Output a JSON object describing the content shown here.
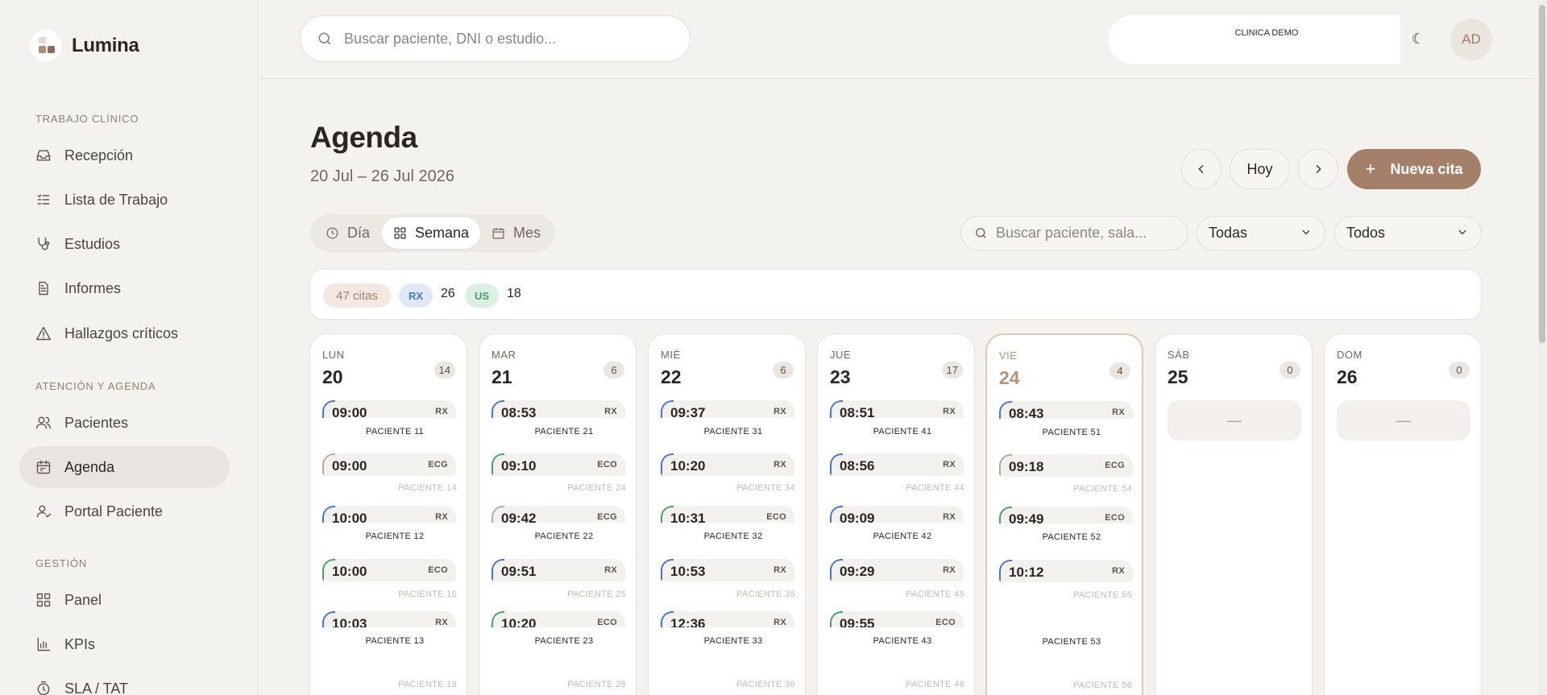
{
  "brand": {
    "name": "Lumina"
  },
  "sidebar": {
    "sections": [
      {
        "title": "TRABAJO CLÍNICO"
      },
      {
        "title": "ATENCIÓN Y AGENDA"
      },
      {
        "title": "GESTIÓN"
      }
    ],
    "items": [
      {
        "label": "Recepción",
        "icon": "inbox-icon"
      },
      {
        "label": "Lista de Trabajo",
        "icon": "list-check-icon"
      },
      {
        "label": "Estudios",
        "icon": "stethoscope-icon"
      },
      {
        "label": "Informes",
        "icon": "document-icon"
      },
      {
        "label": "Hallazgos críticos",
        "icon": "warning-icon"
      },
      {
        "label": "Pacientes",
        "icon": "users-icon"
      },
      {
        "label": "Agenda",
        "icon": "calendar-icon",
        "active": true
      },
      {
        "label": "Portal Paciente",
        "icon": "user-portal-icon"
      },
      {
        "label": "Panel",
        "icon": "grid-icon"
      },
      {
        "label": "KPIs",
        "icon": "bar-chart-icon"
      },
      {
        "label": "SLA / TAT",
        "icon": "timer-icon"
      }
    ]
  },
  "topbar": {
    "search_placeholder": "Buscar paciente, DNI o estudio...",
    "clinic": "CLINICA DEMO",
    "avatar": "AD"
  },
  "page": {
    "title": "Agenda",
    "date_range": "20 Jul – 26 Jul 2026",
    "today_label": "Hoy",
    "new_label": "Nueva cita"
  },
  "views": {
    "day": "Día",
    "week": "Semana",
    "month": "Mes",
    "active": "Semana"
  },
  "filters": {
    "search_placeholder": "Buscar paciente, sala...",
    "room": "Todas",
    "type": "Todos"
  },
  "summary": {
    "total": "47 citas",
    "rx_label": "RX",
    "rx_count": "26",
    "us_label": "US",
    "us_count": "18"
  },
  "colors": {
    "rx": "#4874c9",
    "eco": "#47a06a",
    "ecg": "#b0aaa4",
    "accent": "#a4806b"
  },
  "days": [
    {
      "name": "LUN",
      "num": "20",
      "count": "14",
      "appts": [
        {
          "time": "09:00",
          "mod": "RX"
        },
        {
          "time": "09:00",
          "mod": "ECG"
        },
        {
          "time": "10:00",
          "mod": "RX"
        },
        {
          "time": "10:00",
          "mod": "ECO"
        },
        {
          "time": "10:03",
          "mod": "RX"
        }
      ],
      "patients": [
        "PACIENTE 11",
        "PACIENTE 12",
        "PACIENTE 13"
      ],
      "faint": [
        "PACIENTE 14",
        "PACIENTE 15",
        "PACIENTE 16"
      ]
    },
    {
      "name": "MAR",
      "num": "21",
      "count": "6",
      "appts": [
        {
          "time": "08:53",
          "mod": "RX"
        },
        {
          "time": "09:10",
          "mod": "ECO"
        },
        {
          "time": "09:42",
          "mod": "ECG"
        },
        {
          "time": "09:51",
          "mod": "RX"
        },
        {
          "time": "10:20",
          "mod": "ECO"
        }
      ],
      "patients": [
        "PACIENTE 21",
        "PACIENTE 22",
        "PACIENTE 23"
      ],
      "faint": [
        "PACIENTE 24",
        "PACIENTE 25",
        "PACIENTE 26"
      ]
    },
    {
      "name": "MIÉ",
      "num": "22",
      "count": "6",
      "appts": [
        {
          "time": "09:37",
          "mod": "RX"
        },
        {
          "time": "10:20",
          "mod": "RX"
        },
        {
          "time": "10:31",
          "mod": "ECO"
        },
        {
          "time": "10:53",
          "mod": "RX"
        },
        {
          "time": "12:36",
          "mod": "RX"
        }
      ],
      "patients": [
        "PACIENTE 31",
        "PACIENTE 32",
        "PACIENTE 33"
      ],
      "faint": [
        "PACIENTE 34",
        "PACIENTE 35",
        "PACIENTE 36"
      ]
    },
    {
      "name": "JUE",
      "num": "23",
      "count": "17",
      "appts": [
        {
          "time": "08:51",
          "mod": "RX"
        },
        {
          "time": "08:56",
          "mod": "RX"
        },
        {
          "time": "09:09",
          "mod": "RX"
        },
        {
          "time": "09:29",
          "mod": "RX"
        },
        {
          "time": "09:55",
          "mod": "ECO"
        }
      ],
      "patients": [
        "PACIENTE 41",
        "PACIENTE 42",
        "PACIENTE 43"
      ],
      "faint": [
        "PACIENTE 44",
        "PACIENTE 45",
        "PACIENTE 46"
      ]
    },
    {
      "name": "VIE",
      "num": "24",
      "count": "4",
      "today": true,
      "appts": [
        {
          "time": "08:43",
          "mod": "RX"
        },
        {
          "time": "09:18",
          "mod": "ECG"
        },
        {
          "time": "09:49",
          "mod": "ECO"
        },
        {
          "time": "10:12",
          "mod": "RX"
        }
      ],
      "patients": [
        "PACIENTE 51",
        "PACIENTE 52",
        "PACIENTE 53"
      ],
      "faint": [
        "PACIENTE 54",
        "PACIENTE 55",
        "PACIENTE 56"
      ]
    },
    {
      "name": "SÁB",
      "num": "25",
      "count": "0",
      "empty": "—",
      "appts": [],
      "patients": [],
      "faint": []
    },
    {
      "name": "DOM",
      "num": "26",
      "count": "0",
      "empty": "—",
      "appts": [],
      "patients": [],
      "faint": []
    }
  ]
}
